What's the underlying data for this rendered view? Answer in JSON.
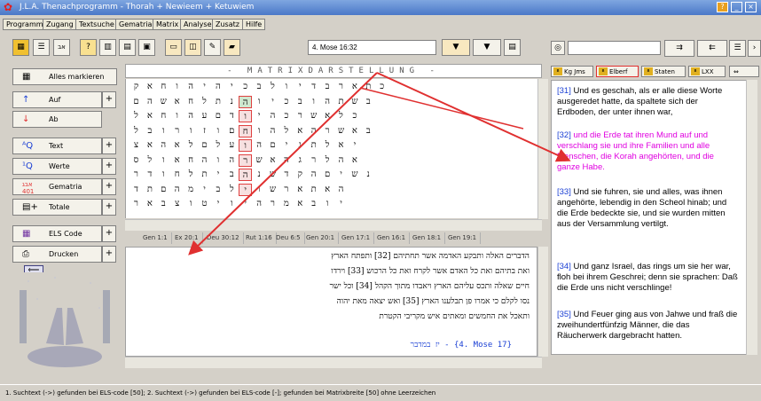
{
  "window": {
    "title": "J.L.A. Thenachprogramm - Thorah + Newieem + Ketuwiem"
  },
  "menu": [
    "Programm",
    "Zugang",
    "Textsuche",
    "Gematria",
    "Matrix",
    "Analyse",
    "Zusatz",
    "Hilfe"
  ],
  "toolbar": {
    "reference_value": "4. Mose 16:32"
  },
  "sidebar": {
    "items": [
      {
        "label": "Alles markieren",
        "icon": "grid-icon"
      },
      {
        "label": "Auf",
        "icon": "arrow-up-icon"
      },
      {
        "label": "Ab",
        "icon": "arrow-down-icon"
      },
      {
        "label": "Text",
        "icon": "text-search-icon"
      },
      {
        "label": "Werte",
        "icon": "value-search-icon"
      },
      {
        "label": "Gematria",
        "icon": "gematria-icon",
        "badge": "401"
      },
      {
        "label": "Totale",
        "icon": "totals-icon"
      },
      {
        "label": "ELS Code",
        "icon": "els-grid-icon"
      },
      {
        "label": "Drucken",
        "icon": "printer-icon"
      }
    ],
    "back_symbol": "⟸"
  },
  "matrix": {
    "header": "- MATRIXDARSTELLUNG -",
    "rows": [
      "קאחוהיהיכבלוידבראתכ",
      "םהשאחלתנהויכבוהתשב",
      "לאחוהעםדויהכרשאלכ",
      "לבורוזוםחוהלאהרשאב",
      "צאהאלםלעוהםינתלאי",
      "סלואחהוהרשאהגרלהא",
      "רדוחלתיבהנשדקהםישנ",
      "דתםהמיבליושראתאה",
      "ראבצוטיויהרמאבוי"
    ]
  },
  "book_tabs": [
    "Gen 1:1",
    "Ex 20:1",
    "Deu 30:12",
    "Rut 1:16",
    "Deu 6:5",
    "Gen 20:1",
    "Gen 17:1",
    "Gen 16:1",
    "Gen 18:1",
    "Gen 19:1"
  ],
  "hebrew_text": {
    "lines": [
      "הדברים האלה ותבקע האדמה אשר תחתיהם [32] ותפתח הארץ",
      "ואת בתיהם ואת כל האדם אשר לקרח ואת כל הרכוש [33] וירדו",
      "חיים שאלה ותכס עליהם הארץ ויאבדו מתוך הקהל [34] וכל ישר",
      "נסו לקלם כי אמרו פן תבלענו הארץ [35] ואש יצאה מאת יהוה",
      "ותאכל את החמשים ומאתים איש מקריבי הקטרת"
    ],
    "footer": "יז במדבר - {4. Mose 17}"
  },
  "translation_tabs": [
    "Kg Jms",
    "Elberf",
    "Staten",
    "LXX"
  ],
  "verses": [
    {
      "num": "[31]",
      "text": "Und es geschah, als er alle diese Worte ausgeredet hatte, da spaltete sich der Erdboden, der unter ihnen war,",
      "color": "#000000"
    },
    {
      "num": "[32]",
      "text": "und die Erde tat ihren Mund auf und verschlang sie und ihre Familien und alle Menschen, die Korah angehörten, und die ganze Habe.",
      "color": "#e000e0"
    },
    {
      "num": "[33]",
      "text": "Und sie fuhren, sie und alles, was ihnen angehörte, lebendig in den Scheol hinab; und die Erde bedeckte sie, und sie wurden mitten aus der Versammlung vertilgt.",
      "color": "#000000"
    },
    {
      "num": "[34]",
      "text": "Und ganz Israel, das rings um sie her war, floh bei ihrem Geschrei; denn sie sprachen: Daß die Erde uns nicht verschlinge!",
      "color": "#000000"
    },
    {
      "num": "[35]",
      "text": "Und Feuer ging aus von Jahwe und fraß die zweihundertfünfzig Männer, die das Räucherwerk dargebracht hatten.",
      "color": "#000000"
    }
  ],
  "verses_footer": "{4. Mose 17}",
  "status": "1. Suchtext (->) gefunden bei ELS-code [50];   2. Suchtext (->) gefunden bei ELS-code [-];   gefunden bei Matrixbreite [50] ohne Leerzeichen",
  "colors": {
    "accent_red": "#e03030",
    "verse_blue": "#1a3fd4",
    "highlight_magenta": "#e000e0"
  }
}
